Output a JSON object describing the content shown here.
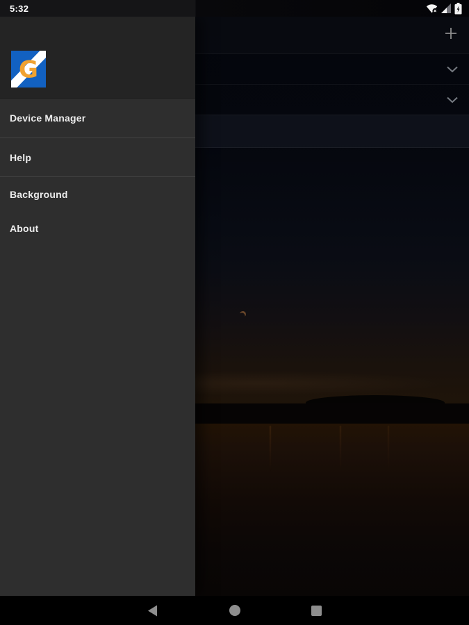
{
  "status_bar": {
    "time": "5:32",
    "icons": {
      "wifi": "wifi-no-connection-icon",
      "signal": "cell-signal-partial-icon",
      "battery": "battery-charging-icon"
    }
  },
  "drawer": {
    "logo": {
      "letter": "G",
      "blue": "#1261c1",
      "stripe": "#ffffff",
      "orange": "#f0a231"
    },
    "items": [
      {
        "label": "Device Manager"
      },
      {
        "label": "Help"
      },
      {
        "label": "Background"
      },
      {
        "label": "About"
      }
    ]
  },
  "main": {
    "toolbar": {
      "add_icon": "plus-icon"
    },
    "sections": [
      {
        "state": "collapsed",
        "icon": "chevron-down-icon"
      },
      {
        "state": "collapsed",
        "icon": "chevron-down-icon"
      }
    ],
    "wallpaper": "dusk-lake-photo"
  },
  "nav_bar": {
    "back": "back-icon",
    "home": "home-icon",
    "recents": "recents-icon"
  },
  "colors": {
    "drawer_bg": "#2e2e2e",
    "drawer_header_bg": "#242424",
    "divider": "#414141",
    "menu_text": "#ececec",
    "nav_bar_bg": "#000000",
    "nav_icon": "#8e8e8e",
    "content_icon": "#8d8d8d"
  }
}
